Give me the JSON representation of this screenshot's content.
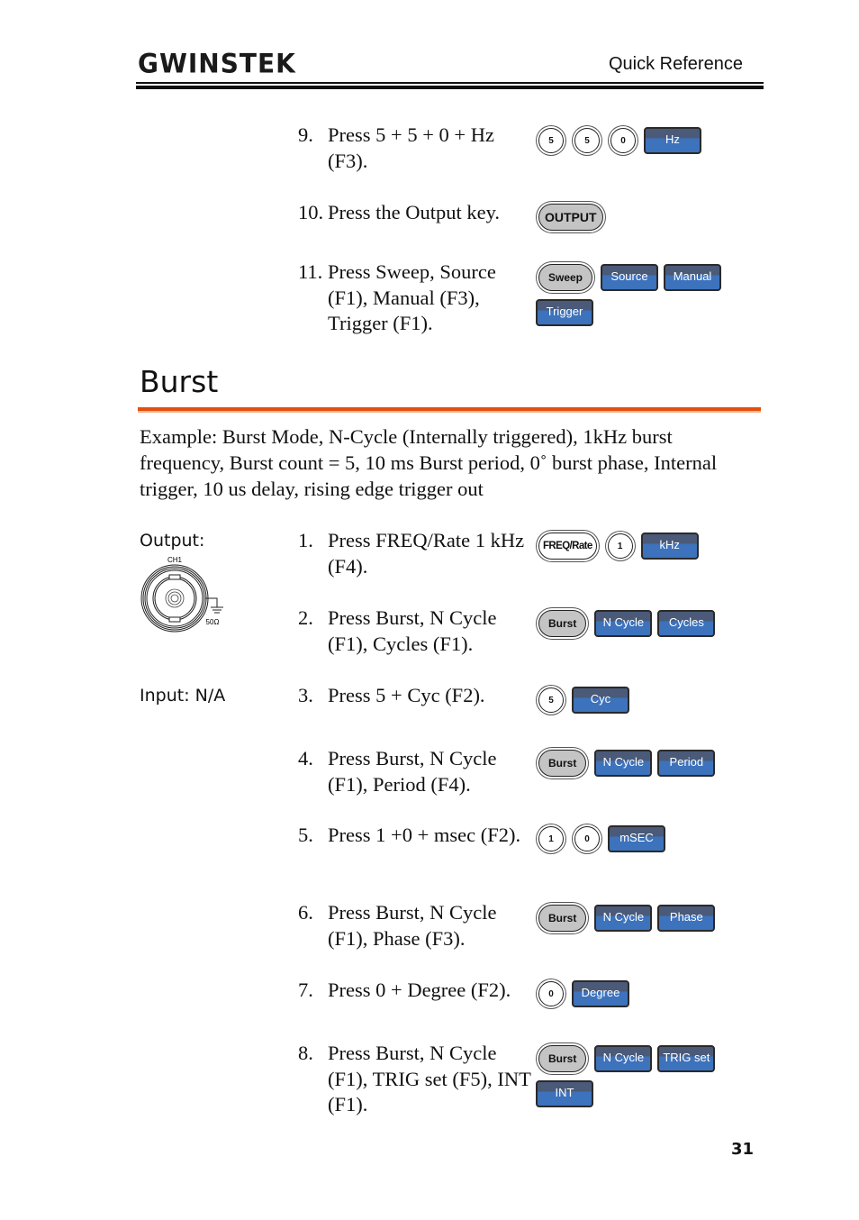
{
  "header": {
    "logo": "GWINSTEK",
    "section": "Quick Reference"
  },
  "steps_top": [
    {
      "num": "9.",
      "text": "Press 5 + 5 + 0 + Hz (F3).",
      "keys": [
        [
          {
            "type": "num",
            "label": "5"
          },
          {
            "type": "num",
            "label": "5"
          },
          {
            "type": "num",
            "label": "0"
          },
          {
            "type": "soft",
            "label": "Hz"
          }
        ]
      ]
    },
    {
      "num": "10.",
      "text": "Press the Output key.",
      "keys": [
        [
          {
            "type": "pill",
            "label": "OUTPUT"
          }
        ]
      ]
    },
    {
      "num": "11.",
      "text": "Press Sweep, Source (F1), Manual (F3), Trigger (F1).",
      "keys": [
        [
          {
            "type": "pill",
            "label": "Sweep"
          },
          {
            "type": "soft",
            "label": "Source"
          },
          {
            "type": "soft",
            "label": "Manual"
          }
        ],
        [
          {
            "type": "soft",
            "label": "Trigger"
          }
        ]
      ]
    }
  ],
  "burst": {
    "title": "Burst",
    "intro": "Example: Burst Mode, N-Cycle (Internally triggered), 1kHz burst frequency, Burst count = 5, 10 ms Burst period, 0˚ burst phase, Internal trigger, 10 us delay, rising edge trigger out",
    "output_label": "Output:",
    "connector_channel": "CH1",
    "connector_impedance": "50Ω",
    "input_label": "Input: N/A",
    "steps": [
      {
        "num": "1.",
        "text": "Press FREQ/Rate 1 kHz (F4).",
        "keys": [
          [
            {
              "type": "pill-white",
              "label": "FREQ/Rate"
            },
            {
              "type": "num",
              "label": "1"
            },
            {
              "type": "soft",
              "label": "kHz"
            }
          ]
        ]
      },
      {
        "num": "2.",
        "text": "Press Burst, N Cycle (F1), Cycles (F1).",
        "keys": [
          [
            {
              "type": "pill",
              "label": "Burst"
            },
            {
              "type": "soft",
              "label": "N Cycle"
            },
            {
              "type": "soft",
              "label": "Cycles"
            }
          ]
        ]
      },
      {
        "num": "3.",
        "text": "Press 5 + Cyc (F2).",
        "keys": [
          [
            {
              "type": "num",
              "label": "5"
            },
            {
              "type": "soft",
              "label": "Cyc"
            }
          ]
        ]
      },
      {
        "num": "4.",
        "text": "Press Burst, N Cycle (F1), Period (F4).",
        "keys": [
          [
            {
              "type": "pill",
              "label": "Burst"
            },
            {
              "type": "soft",
              "label": "N Cycle"
            },
            {
              "type": "soft",
              "label": "Period"
            }
          ]
        ]
      },
      {
        "num": "5.",
        "text": "Press 1 +0 + msec (F2).",
        "keys": [
          [
            {
              "type": "num",
              "label": "1"
            },
            {
              "type": "num",
              "label": "0"
            },
            {
              "type": "soft",
              "label": "mSEC"
            }
          ]
        ]
      },
      {
        "num": "6.",
        "text": "Press Burst, N Cycle (F1), Phase (F3).",
        "keys": [
          [
            {
              "type": "pill",
              "label": "Burst"
            },
            {
              "type": "soft",
              "label": "N Cycle"
            },
            {
              "type": "soft",
              "label": "Phase"
            }
          ]
        ]
      },
      {
        "num": "7.",
        "text": "Press 0 + Degree (F2).",
        "keys": [
          [
            {
              "type": "num",
              "label": "0"
            },
            {
              "type": "soft",
              "label": "Degree"
            }
          ]
        ]
      },
      {
        "num": "8.",
        "text": "Press Burst, N Cycle (F1), TRIG set (F5), INT (F1).",
        "keys": [
          [
            {
              "type": "pill",
              "label": "Burst"
            },
            {
              "type": "soft",
              "label": "N Cycle"
            },
            {
              "type": "soft",
              "label": "TRIG set"
            }
          ],
          [
            {
              "type": "soft",
              "label": "INT"
            }
          ]
        ]
      }
    ]
  },
  "footer": {
    "page_number": "31"
  }
}
